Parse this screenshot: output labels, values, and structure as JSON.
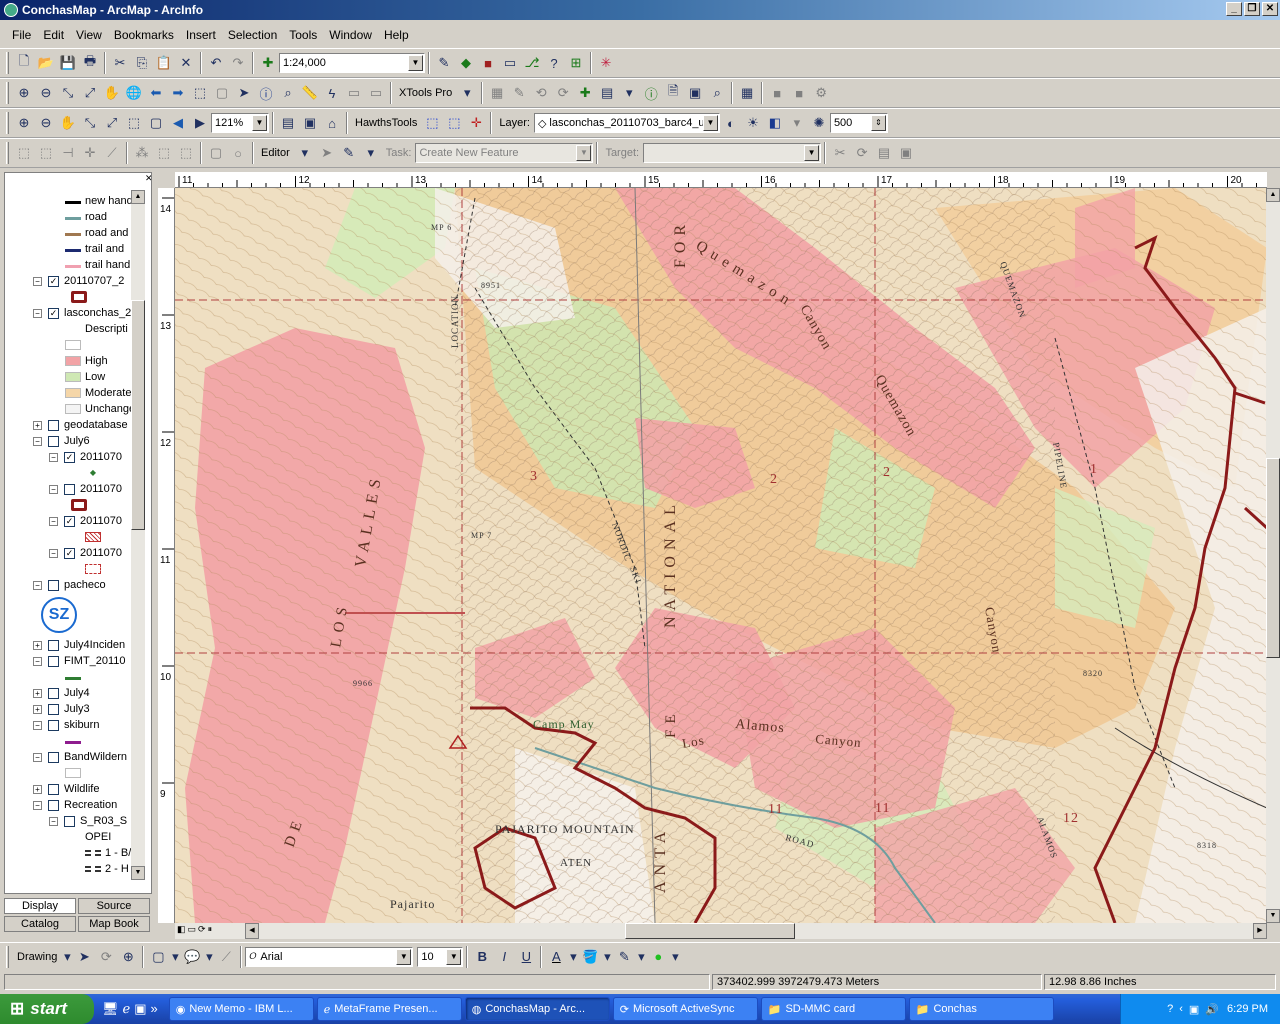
{
  "window": {
    "title": "ConchasMap - ArcMap - ArcInfo"
  },
  "menu": [
    "File",
    "Edit",
    "View",
    "Bookmarks",
    "Insert",
    "Selection",
    "Tools",
    "Window",
    "Help"
  ],
  "toolbar1": {
    "scale": "1:24,000"
  },
  "toolbar2": {
    "xtools": "XTools Pro"
  },
  "toolbar3": {
    "zoom": "121%",
    "hawths": "HawthsTools",
    "layer_label": "Layer:",
    "layer_value": "lasconchas_20110703_barc4_u",
    "transparency": "500"
  },
  "editor": {
    "editor": "Editor",
    "task_label": "Task:",
    "task_value": "Create New Feature",
    "target_label": "Target:"
  },
  "toc": {
    "items": [
      {
        "label": "new hand",
        "kind": "legend",
        "swatch": "#000000"
      },
      {
        "label": "road",
        "kind": "legend",
        "swatch": "#6e9e9e"
      },
      {
        "label": "road and",
        "kind": "legend",
        "swatch": "#a07850"
      },
      {
        "label": "trail and",
        "kind": "legend",
        "swatch": "#1c2a70"
      },
      {
        "label": "trail hand",
        "kind": "legend",
        "swatch": "#f0a0b0"
      },
      {
        "label": "20110707_2",
        "kind": "layer",
        "expanded": true,
        "checked": true
      },
      {
        "label": "",
        "kind": "poly",
        "swatch": "#8b1a1a"
      },
      {
        "label": "lasconchas_2",
        "kind": "layer",
        "expanded": true,
        "checked": true
      },
      {
        "label": "Descripti",
        "kind": "text"
      },
      {
        "label": "",
        "kind": "fill",
        "swatch": "#ffffff"
      },
      {
        "label": "High",
        "kind": "fill",
        "swatch": "#f2a3a6"
      },
      {
        "label": "Low",
        "kind": "fill",
        "swatch": "#cfe8b4"
      },
      {
        "label": "Moderate",
        "kind": "fill",
        "swatch": "#f5d6a8"
      },
      {
        "label": "Unchange",
        "kind": "fill",
        "swatch": "#f4f4f4"
      },
      {
        "label": "geodatabase",
        "kind": "layer",
        "expanded": false,
        "checked": false
      },
      {
        "label": "July6",
        "kind": "layer",
        "expanded": true,
        "checked": false
      },
      {
        "label": "2011070",
        "kind": "sublayer",
        "expanded": true,
        "checked": true
      },
      {
        "label": "",
        "kind": "point",
        "swatch": "#2e7d32"
      },
      {
        "label": "2011070",
        "kind": "sublayer",
        "expanded": true,
        "checked": false
      },
      {
        "label": "",
        "kind": "poly",
        "swatch": "#8b1a1a"
      },
      {
        "label": "2011070",
        "kind": "sublayer",
        "expanded": true,
        "checked": true
      },
      {
        "label": "",
        "kind": "hatch",
        "swatch": "#c03030"
      },
      {
        "label": "2011070",
        "kind": "sublayer",
        "expanded": true,
        "checked": true
      },
      {
        "label": "",
        "kind": "dash",
        "swatch": "#c03030"
      },
      {
        "label": "pacheco",
        "kind": "layer",
        "expanded": true,
        "checked": false
      },
      {
        "label": "SZ",
        "kind": "logo"
      },
      {
        "label": "July4Inciden",
        "kind": "layer",
        "expanded": false,
        "checked": false
      },
      {
        "label": "FIMT_20110",
        "kind": "layer",
        "expanded": true,
        "checked": false
      },
      {
        "label": "",
        "kind": "legend",
        "swatch": "#2e7d32"
      },
      {
        "label": "July4",
        "kind": "layer",
        "expanded": false,
        "checked": false
      },
      {
        "label": "July3",
        "kind": "layer",
        "expanded": false,
        "checked": false
      },
      {
        "label": "skiburn",
        "kind": "layer",
        "expanded": true,
        "checked": false
      },
      {
        "label": "",
        "kind": "legend",
        "swatch": "#8e1c8e"
      },
      {
        "label": "BandWildern",
        "kind": "layer",
        "expanded": true,
        "checked": false
      },
      {
        "label": "",
        "kind": "fill",
        "swatch": "#ffffff"
      },
      {
        "label": "Wildlife",
        "kind": "layer",
        "expanded": false,
        "checked": false
      },
      {
        "label": "Recreation",
        "kind": "layer",
        "expanded": true,
        "checked": false
      },
      {
        "label": "S_R03_S",
        "kind": "sublayer",
        "expanded": true,
        "checked": false
      },
      {
        "label": "OPEI",
        "kind": "text"
      },
      {
        "label": "1 - B/",
        "kind": "legend2"
      },
      {
        "label": "2 - H",
        "kind": "legend2"
      }
    ],
    "tabs": [
      "Display",
      "Source",
      "Catalog",
      "Map Book"
    ]
  },
  "ruler_top": [
    "11",
    "12",
    "13",
    "14",
    "15",
    "16",
    "17",
    "18",
    "19",
    "20"
  ],
  "ruler_left": [
    "14",
    "13",
    "12",
    "11",
    "10",
    "9"
  ],
  "map_labels": [
    {
      "t": "Quemazon",
      "a": "quem1"
    },
    {
      "t": "Canyon",
      "a": "can1"
    },
    {
      "t": "Quemazon",
      "a": "quem2"
    },
    {
      "t": "FOR",
      "a": "for"
    },
    {
      "t": "NATIONAL",
      "a": "nat"
    },
    {
      "t": "VALLES",
      "a": "valles"
    },
    {
      "t": "Camp May",
      "a": "campmay"
    },
    {
      "t": "Los",
      "a": "los"
    },
    {
      "t": "Alamos",
      "a": "alamos"
    },
    {
      "t": "Canyon",
      "a": "can2"
    },
    {
      "t": "Canyon",
      "a": "can3"
    },
    {
      "t": "PAJARITO MOUNTAIN",
      "a": "pajmtn"
    },
    {
      "t": "Pajarito",
      "a": "pajtown"
    },
    {
      "t": "LOCATION",
      "a": "loc"
    },
    {
      "t": "3",
      "a": "n3"
    },
    {
      "t": "2",
      "a": "n2a"
    },
    {
      "t": "2",
      "a": "n2b"
    },
    {
      "t": "1",
      "a": "n1"
    },
    {
      "t": "11",
      "a": "n11a"
    },
    {
      "t": "11",
      "a": "n11b"
    },
    {
      "t": "12",
      "a": "n12"
    },
    {
      "t": "8951",
      "a": "e1"
    },
    {
      "t": "9966",
      "a": "e2"
    },
    {
      "t": "8320",
      "a": "e3"
    },
    {
      "t": "8318",
      "a": "e4"
    },
    {
      "t": "MP 6",
      "a": "mp6"
    },
    {
      "t": "MP 7",
      "a": "mp7"
    },
    {
      "t": "ANTA",
      "a": "anta"
    },
    {
      "t": "FE",
      "a": "fe"
    },
    {
      "t": "DE",
      "a": "de"
    },
    {
      "t": "LOS",
      "a": "losv"
    },
    {
      "t": "ROAD",
      "a": "road"
    },
    {
      "t": "QUEMAZON",
      "a": "quemtrail"
    },
    {
      "t": "PIPELINE",
      "a": "pipe"
    },
    {
      "t": "ALAMOS",
      "a": "alamostr"
    },
    {
      "t": "ATEN",
      "a": "aten"
    },
    {
      "t": "NORDIC",
      "a": "nordic"
    },
    {
      "t": "SKI",
      "a": "ski"
    }
  ],
  "drawing": {
    "label": "Drawing",
    "font": "Arial",
    "size": "10"
  },
  "status": {
    "coords": "373402.999  3972479.473 Meters",
    "page": "12.98  8.86 Inches"
  },
  "taskbar": {
    "start": "start",
    "tasks": [
      "New Memo - IBM L...",
      "MetaFrame Presen...",
      "ConchasMap - Arc...",
      "Microsoft ActiveSync",
      "SD-MMC card",
      "Conchas"
    ],
    "clock": "6:29 PM"
  }
}
